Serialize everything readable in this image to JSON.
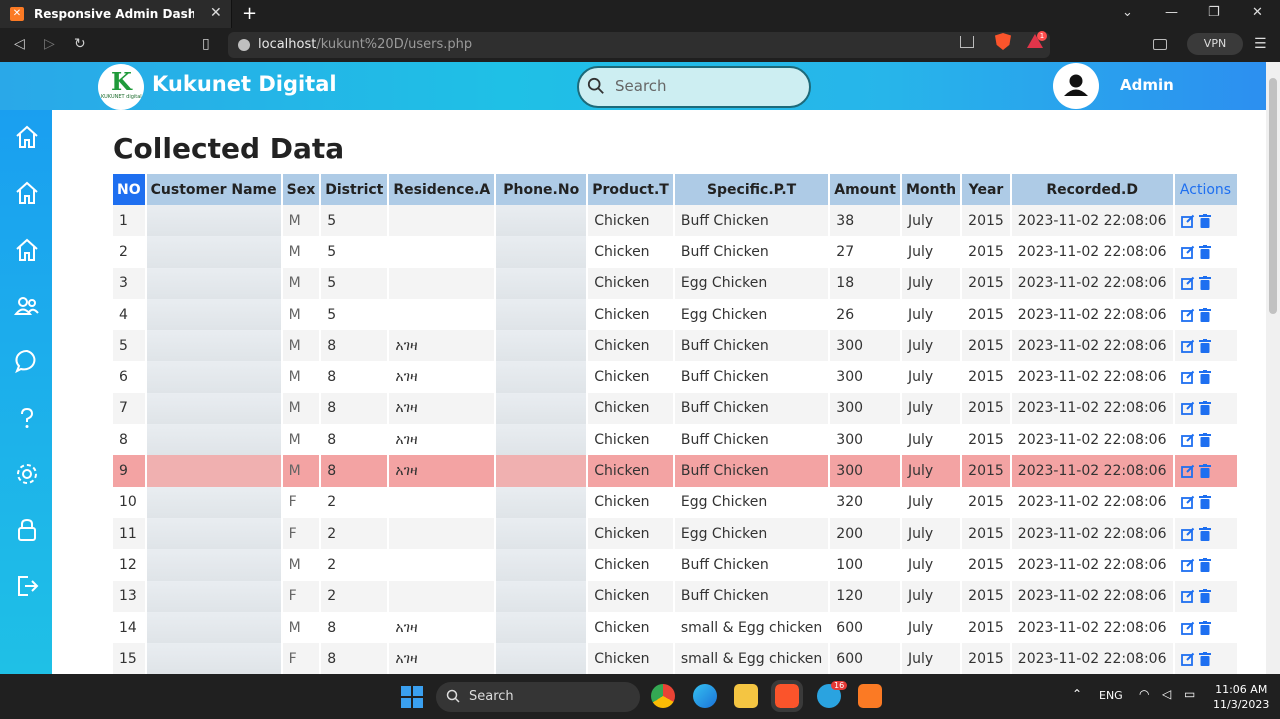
{
  "browser": {
    "tab_title": "Responsive Admin Dashboar",
    "url_host": "localhost",
    "url_path": "/kukunt%20D/users.php",
    "vpn_label": "VPN",
    "rewards_badge": "1"
  },
  "header": {
    "brand": "Kukunet Digital",
    "logo_letter": "K",
    "logo_caption": "KUKUNET digital",
    "search_placeholder": "Search",
    "user_label": "Admin"
  },
  "sidebar": {
    "items": [
      "home-icon",
      "home-icon",
      "home-icon",
      "users-icon",
      "chat-icon",
      "help-icon",
      "settings-icon",
      "lock-icon",
      "sign-out-icon"
    ]
  },
  "main": {
    "title": "Collected Data",
    "columns": [
      "NO",
      "Customer Name",
      "Sex",
      "District",
      "Residence.A",
      "Phone.No",
      "Product.T",
      "Specific.P.T",
      "Amount",
      "Month",
      "Year",
      "Recorded.D",
      "Actions"
    ],
    "rows": [
      {
        "no": "1",
        "sex": "M",
        "district": "5",
        "residence": "",
        "product": "Chicken",
        "specific": "Buff Chicken",
        "amount": "38",
        "month": "July",
        "year": "2015",
        "recorded": "2023-11-02 22:08:06"
      },
      {
        "no": "2",
        "sex": "M",
        "district": "5",
        "residence": "",
        "product": "Chicken",
        "specific": "Buff Chicken",
        "amount": "27",
        "month": "July",
        "year": "2015",
        "recorded": "2023-11-02 22:08:06"
      },
      {
        "no": "3",
        "sex": "M",
        "district": "5",
        "residence": "",
        "product": "Chicken",
        "specific": "Egg Chicken",
        "amount": "18",
        "month": "July",
        "year": "2015",
        "recorded": "2023-11-02 22:08:06"
      },
      {
        "no": "4",
        "sex": "M",
        "district": "5",
        "residence": "",
        "product": "Chicken",
        "specific": "Egg Chicken",
        "amount": "26",
        "month": "July",
        "year": "2015",
        "recorded": "2023-11-02 22:08:06"
      },
      {
        "no": "5",
        "sex": "M",
        "district": "8",
        "residence": "አገዛ",
        "product": "Chicken",
        "specific": "Buff Chicken",
        "amount": "300",
        "month": "July",
        "year": "2015",
        "recorded": "2023-11-02 22:08:06"
      },
      {
        "no": "6",
        "sex": "M",
        "district": "8",
        "residence": "አገዛ",
        "product": "Chicken",
        "specific": "Buff Chicken",
        "amount": "300",
        "month": "July",
        "year": "2015",
        "recorded": "2023-11-02 22:08:06"
      },
      {
        "no": "7",
        "sex": "M",
        "district": "8",
        "residence": "አገዛ",
        "product": "Chicken",
        "specific": "Buff Chicken",
        "amount": "300",
        "month": "July",
        "year": "2015",
        "recorded": "2023-11-02 22:08:06"
      },
      {
        "no": "8",
        "sex": "M",
        "district": "8",
        "residence": "አገዛ",
        "product": "Chicken",
        "specific": "Buff Chicken",
        "amount": "300",
        "month": "July",
        "year": "2015",
        "recorded": "2023-11-02 22:08:06"
      },
      {
        "no": "9",
        "sex": "M",
        "district": "8",
        "residence": "አገዛ",
        "product": "Chicken",
        "specific": "Buff Chicken",
        "amount": "300",
        "month": "July",
        "year": "2015",
        "recorded": "2023-11-02 22:08:06"
      },
      {
        "no": "10",
        "sex": "F",
        "district": "2",
        "residence": "",
        "product": "Chicken",
        "specific": "Egg Chicken",
        "amount": "320",
        "month": "July",
        "year": "2015",
        "recorded": "2023-11-02 22:08:06"
      },
      {
        "no": "11",
        "sex": "F",
        "district": "2",
        "residence": "",
        "product": "Chicken",
        "specific": "Egg Chicken",
        "amount": "200",
        "month": "July",
        "year": "2015",
        "recorded": "2023-11-02 22:08:06"
      },
      {
        "no": "12",
        "sex": "M",
        "district": "2",
        "residence": "",
        "product": "Chicken",
        "specific": "Buff Chicken",
        "amount": "100",
        "month": "July",
        "year": "2015",
        "recorded": "2023-11-02 22:08:06"
      },
      {
        "no": "13",
        "sex": "F",
        "district": "2",
        "residence": "",
        "product": "Chicken",
        "specific": "Buff Chicken",
        "amount": "120",
        "month": "July",
        "year": "2015",
        "recorded": "2023-11-02 22:08:06"
      },
      {
        "no": "14",
        "sex": "M",
        "district": "8",
        "residence": "አገዛ",
        "product": "Chicken",
        "specific": "small & Egg chicken",
        "amount": "600",
        "month": "July",
        "year": "2015",
        "recorded": "2023-11-02 22:08:06"
      },
      {
        "no": "15",
        "sex": "F",
        "district": "8",
        "residence": "አገዛ",
        "product": "Chicken",
        "specific": "small & Egg chicken",
        "amount": "600",
        "month": "July",
        "year": "2015",
        "recorded": "2023-11-02 22:08:06"
      }
    ],
    "highlighted_row": "9",
    "highlight_color": "#f3a3a3"
  },
  "taskbar": {
    "search_label": "Search",
    "lang": "ENG",
    "time": "11:06 AM",
    "date": "11/3/2023",
    "telegram_badge": "16"
  },
  "colors": {
    "accent": "#1e6ff0",
    "header_bg": "#aecbe6",
    "sidebar": "#1fc0e6"
  }
}
